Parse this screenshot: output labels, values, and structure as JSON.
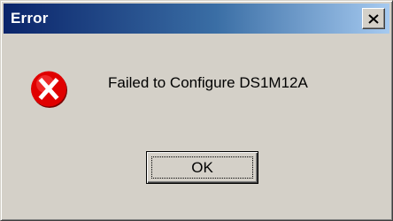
{
  "window": {
    "title": "Error",
    "title_gradient": [
      "#0a246a",
      "#a6caf0"
    ],
    "face_color": "#d4d0c8"
  },
  "titlebar": {
    "close_icon": "close-icon"
  },
  "content": {
    "icon": "error-icon",
    "icon_color": "#e00000",
    "message": "Failed to Configure DS1M12A"
  },
  "buttons": {
    "ok_label": "OK"
  }
}
